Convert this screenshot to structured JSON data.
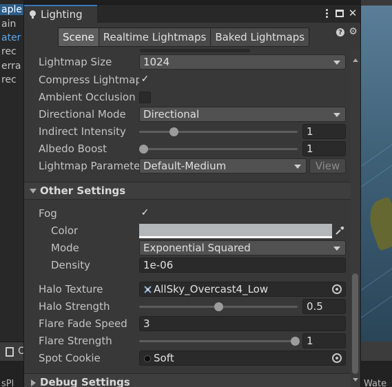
{
  "background_left": {
    "lines": [
      "aple",
      "ain",
      "ater",
      "rec",
      "erra",
      "rec"
    ]
  },
  "background_right": {
    "bottom_text": "Wate"
  },
  "bottom_left_strip": {
    "label": "C"
  },
  "bottom_left_text": "sPl",
  "window": {
    "tab_title": "Lighting",
    "controls": [
      "menu",
      "maximize",
      "close"
    ]
  },
  "toolbar": {
    "tabs": [
      {
        "label": "Scene",
        "selected": true
      },
      {
        "label": "Realtime Lightmaps",
        "selected": false
      },
      {
        "label": "Baked Lightmaps",
        "selected": false
      }
    ]
  },
  "lightmapping": {
    "lightmap_size": {
      "label": "Lightmap Size",
      "value": "1024"
    },
    "compress_lightmaps": {
      "label": "Compress Lightmap",
      "checked": true,
      "check_glyph": "✓"
    },
    "ambient_occlusion": {
      "label": "Ambient Occlusion",
      "checked": false
    },
    "directional_mode": {
      "label": "Directional Mode",
      "value": "Directional"
    },
    "indirect_intensity": {
      "label": "Indirect Intensity",
      "value": "1",
      "slider_fraction": 0.2
    },
    "albedo_boost": {
      "label": "Albedo Boost",
      "value": "1",
      "slider_fraction": 0.0
    },
    "lightmap_parameters": {
      "label": "Lightmap Parameter",
      "value": "Default-Medium",
      "view_label": "View"
    }
  },
  "other_settings": {
    "header": "Other Settings",
    "fog": {
      "label": "Fog",
      "checked": true,
      "check_glyph": "✓"
    },
    "color": {
      "label": "Color",
      "value": "#b4b7ba"
    },
    "mode": {
      "label": "Mode",
      "value": "Exponential Squared"
    },
    "density": {
      "label": "Density",
      "value": "1e-06"
    },
    "halo_texture": {
      "label": "Halo Texture",
      "value": "AllSky_Overcast4_Low"
    },
    "halo_strength": {
      "label": "Halo Strength",
      "value": "0.5",
      "slider_fraction": 0.5
    },
    "flare_fade_speed": {
      "label": "Flare Fade Speed",
      "value": "3"
    },
    "flare_strength": {
      "label": "Flare Strength",
      "value": "1",
      "slider_fraction": 1.0
    },
    "spot_cookie": {
      "label": "Spot Cookie",
      "value": "Soft"
    }
  },
  "debug_settings": {
    "header": "Debug Settings"
  },
  "colors": {
    "window_bg": "#383838",
    "tab_accent": "#3a79bb",
    "field_bg": "#2a2a2a",
    "dropdown_bg": "#515151"
  }
}
